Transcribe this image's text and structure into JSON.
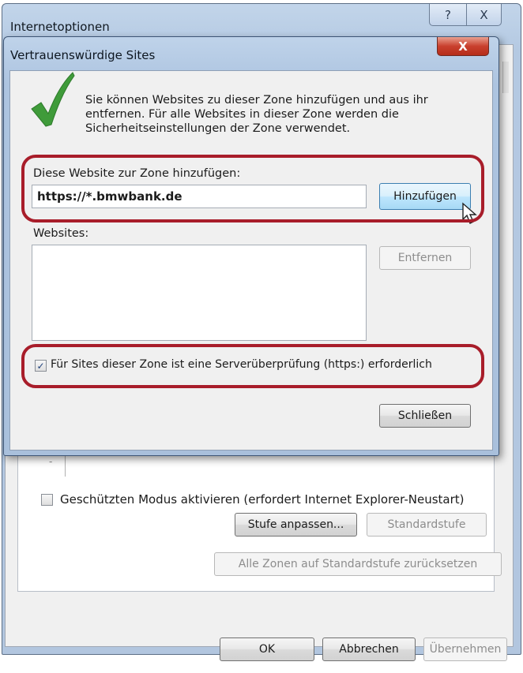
{
  "outer_window": {
    "title": "Internetoptionen",
    "help_button": "?",
    "close_button": "X",
    "protected_mode": {
      "label": "Geschützten Modus aktivieren (erfordert Internet Explorer-Neustart)",
      "checked": false
    },
    "buttons": {
      "custom_level": "Stufe anpassen...",
      "default_level": "Standardstufe",
      "reset_all": "Alle Zonen auf Standardstufe zurücksetzen",
      "ok": "OK",
      "cancel": "Abbrechen",
      "apply": "Übernehmen"
    }
  },
  "dialog": {
    "title": "Vertrauenswürdige Sites",
    "close_button": "X",
    "info_text": "Sie können Websites zu dieser Zone hinzufügen und aus ihr entfernen. Für alle Websites in dieser Zone werden die Sicherheitseinstellungen der Zone verwendet.",
    "add_label": "Diese Website zur Zone hinzufügen:",
    "add_value": "https://*.bmwbank.de",
    "add_button": "Hinzufügen",
    "websites_label": "Websites:",
    "websites": [],
    "remove_button": "Entfernen",
    "https_check": {
      "label": "Für Sites dieser Zone ist eine Serverüberprüfung (https:) erforderlich",
      "checked": true,
      "mark": "✓"
    },
    "close_dialog_button": "Schließen"
  },
  "highlight_color": "#a81d2a",
  "checkmark_color": "#3f9b3a",
  "icons": [
    "checkmark-icon",
    "mouse-cursor-icon",
    "help-icon",
    "close-icon"
  ]
}
